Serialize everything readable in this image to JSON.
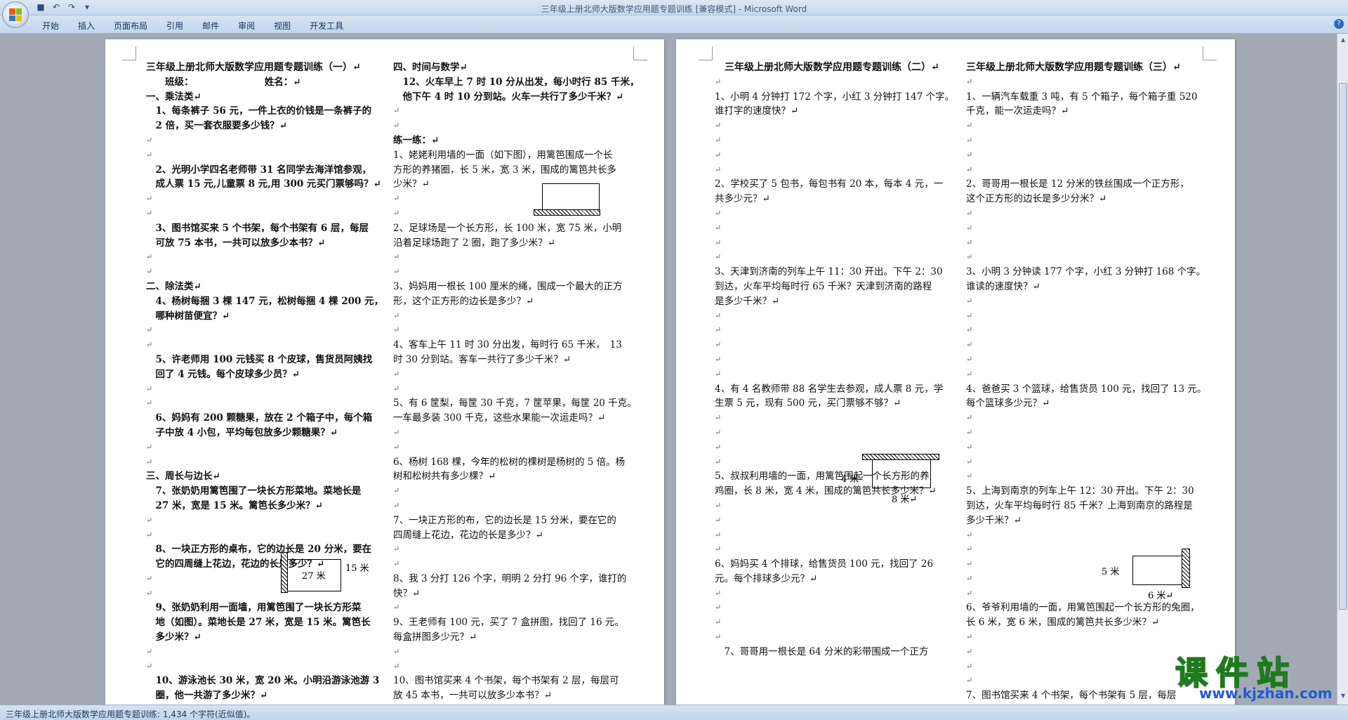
{
  "window": {
    "title": "三年级上册北师大版数学应用题专题训练 [兼容模式] - Microsoft Word"
  },
  "ribbon": {
    "tabs": [
      "开始",
      "插入",
      "页面布局",
      "引用",
      "邮件",
      "审阅",
      "视图",
      "开发工具"
    ]
  },
  "status": {
    "text": "三年级上册北师大版数学应用题专题训练: 1,434 个字符(近似值)。"
  },
  "watermark": {
    "cn": "课件站",
    "url": "www.kjzhan.com"
  },
  "page1_left": [
    {
      "t": "三年级上册北师大版数学应用题专题训练（一）↵",
      "s": "title"
    },
    {
      "t": "　　班级：　　　　　　　　姓名：↵",
      "s": "b"
    },
    {
      "t": "一、乘法类↵",
      "s": "b"
    },
    {
      "t": "　1、每条裤子 56 元，一件上衣的价钱是一条裤子的",
      "s": "b"
    },
    {
      "t": "　2 倍，买一套衣服要多少钱？↵",
      "s": "b"
    },
    {
      "t": "↵",
      "s": "mark"
    },
    {
      "t": "↵",
      "s": "mark"
    },
    {
      "t": "　2、光明小学四名老师带 31 名同学去海洋馆参观，",
      "s": "b"
    },
    {
      "t": "　成人票 15 元,儿童票 8 元,用 300 元买门票够吗？↵",
      "s": "b"
    },
    {
      "t": "↵",
      "s": "mark"
    },
    {
      "t": "↵",
      "s": "mark"
    },
    {
      "t": "　3、图书馆买来 5 个书架，每个书架有 6 层，每层",
      "s": "b"
    },
    {
      "t": "　可放 75 本书，一共可以放多少本书？↵",
      "s": "b"
    },
    {
      "t": "↵",
      "s": "mark"
    },
    {
      "t": "↵",
      "s": "mark"
    },
    {
      "t": "二、除法类↵",
      "s": "b"
    },
    {
      "t": "　4、杨树每捆 3 棵 147 元，松树每捆 4 棵 200 元，",
      "s": "b"
    },
    {
      "t": "　哪种树苗便宜？↵",
      "s": "b"
    },
    {
      "t": "↵",
      "s": "mark"
    },
    {
      "t": "↵",
      "s": "mark"
    },
    {
      "t": "　5、许老师用 100 元钱买 8 个皮球，售货员阿姨找",
      "s": "b"
    },
    {
      "t": "　回了 4 元钱。每个皮球多少员？↵",
      "s": "b"
    },
    {
      "t": "↵",
      "s": "mark"
    },
    {
      "t": "↵",
      "s": "mark"
    },
    {
      "t": "　6、妈妈有 200 颗糖果，放在 2 个箱子中，每个箱",
      "s": "b"
    },
    {
      "t": "　子中放 4 小包，平均每包放多少颗糖果？↵",
      "s": "b"
    },
    {
      "t": "↵",
      "s": "mark"
    },
    {
      "t": "↵",
      "s": "mark"
    },
    {
      "t": "三、周长与边长↵",
      "s": "b"
    },
    {
      "t": "　7、张奶奶用篱笆围了一块长方形菜地。菜地长是",
      "s": "b"
    },
    {
      "t": "　27 米，宽是 15 米。篱笆长多少米？↵",
      "s": "b"
    },
    {
      "t": "↵",
      "s": "mark"
    },
    {
      "t": "↵",
      "s": "mark"
    },
    {
      "t": "　8、一块正方形的桌布，它的边长是 20 分米，要在",
      "s": "b"
    },
    {
      "t": "　它的四周缝上花边，花边的长是多少？↵",
      "s": "b"
    },
    {
      "t": "↵",
      "s": "mark"
    },
    {
      "t": "↵",
      "s": "mark"
    },
    {
      "t": "　9、张奶奶利用一面墙，用篱笆围了一块长方形菜",
      "s": "b"
    },
    {
      "t": "　地（如图）。菜地长是 27 米，宽是 15 米。篱笆长",
      "s": "b"
    },
    {
      "t": "　多少米？↵",
      "s": "b"
    },
    {
      "t": "↵",
      "s": "mark"
    },
    {
      "t": "↵",
      "s": "mark"
    },
    {
      "t": "　10、游泳池长 30 米，宽 20 米。小明沿游泳池游 3",
      "s": "b"
    },
    {
      "t": "　圈，他一共游了多少米？↵",
      "s": "b"
    }
  ],
  "page1_right": [
    {
      "t": "四、时间与数学↵",
      "s": "b"
    },
    {
      "t": "　12、火车早上 7 时 10 分从出发，每小时行 85 千米，",
      "s": "b"
    },
    {
      "t": "　他下午 4 时 10 分到站。火车一共行了多少千米？↵",
      "s": "b"
    },
    {
      "t": "↵",
      "s": "mark"
    },
    {
      "t": "↵",
      "s": "mark"
    },
    {
      "t": "练一练：↵",
      "s": "b"
    },
    {
      "t": "1、姥姥利用墙的一面（如下图），用篱笆围成一个长",
      "s": ""
    },
    {
      "t": "方形的养猪圈，长 5 米，宽 3 米，围成的篱笆共长多",
      "s": ""
    },
    {
      "t": "少米？↵",
      "s": ""
    },
    {
      "t": "↵",
      "s": "mark"
    },
    {
      "t": "↵",
      "s": "mark"
    },
    {
      "t": "2、足球场是一个长方形，长 100 米，宽 75 米，小明",
      "s": ""
    },
    {
      "t": "沿着足球场跑了 2 圈，跑了多少米？↵",
      "s": ""
    },
    {
      "t": "↵",
      "s": "mark"
    },
    {
      "t": "↵",
      "s": "mark"
    },
    {
      "t": "3、妈妈用一根长 100 厘米的绳，围成一个最大的正方",
      "s": ""
    },
    {
      "t": "形，这个正方形的边长是多少？↵",
      "s": ""
    },
    {
      "t": "↵",
      "s": "mark"
    },
    {
      "t": "↵",
      "s": "mark"
    },
    {
      "t": "4、客车上午 11 时 30 分出发，每时行 65 千米，　13",
      "s": ""
    },
    {
      "t": "时 30 分到站。客车一共行了多少千米？↵",
      "s": ""
    },
    {
      "t": "↵",
      "s": "mark"
    },
    {
      "t": "↵",
      "s": "mark"
    },
    {
      "t": "5、有 6 筐梨，每筐 30 千克，7 筐苹果，每筐 20 千克。",
      "s": ""
    },
    {
      "t": "一车最多装 300 千克，这些水果能一次运走吗？↵",
      "s": ""
    },
    {
      "t": "↵",
      "s": "mark"
    },
    {
      "t": "↵",
      "s": "mark"
    },
    {
      "t": "6、杨树 168 棵，今年的松树的棵树是杨树的 5 倍。杨",
      "s": ""
    },
    {
      "t": "树和松树共有多少棵？↵",
      "s": ""
    },
    {
      "t": "↵",
      "s": "mark"
    },
    {
      "t": "↵",
      "s": "mark"
    },
    {
      "t": "7、一块正方形的布，它的边长是 15 分米，要在它的",
      "s": ""
    },
    {
      "t": "四周缝上花边，花边的长是多少？↵",
      "s": ""
    },
    {
      "t": "↵",
      "s": "mark"
    },
    {
      "t": "↵",
      "s": "mark"
    },
    {
      "t": "8、我 3 分打 126 个字，明明 2 分打 96 个字，谁打的",
      "s": ""
    },
    {
      "t": "快？↵",
      "s": ""
    },
    {
      "t": "↵",
      "s": "mark"
    },
    {
      "t": "9、王老师有 100 元，买了 7 盒拼图，找回了 16 元。",
      "s": ""
    },
    {
      "t": "每盒拼图多少元？↵",
      "s": ""
    },
    {
      "t": "↵",
      "s": "mark"
    },
    {
      "t": "↵",
      "s": "mark"
    },
    {
      "t": "10、图书馆买来 4 个书架，每个书架有 2 层，每层可",
      "s": ""
    },
    {
      "t": "放 45 本书，一共可以放多少本书？↵",
      "s": ""
    }
  ],
  "page2_left": [
    {
      "t": "　三年级上册北师大版数学应用题专题训练（二）↵",
      "s": "title"
    },
    {
      "t": "↵",
      "s": "mark"
    },
    {
      "t": "1、小明 4 分钟打 172 个字，小红 3 分钟打 147 个字。",
      "s": ""
    },
    {
      "t": "谁打字的速度快？↵",
      "s": ""
    },
    {
      "t": "↵",
      "s": "mark"
    },
    {
      "t": "↵",
      "s": "mark"
    },
    {
      "t": "↵",
      "s": "mark"
    },
    {
      "t": "↵",
      "s": "mark"
    },
    {
      "t": "2、学校买了 5 包书，每包书有 20 本，每本 4 元，一",
      "s": ""
    },
    {
      "t": "共多少元？↵",
      "s": ""
    },
    {
      "t": "↵",
      "s": "mark"
    },
    {
      "t": "↵",
      "s": "mark"
    },
    {
      "t": "↵",
      "s": "mark"
    },
    {
      "t": "↵",
      "s": "mark"
    },
    {
      "t": "3、天津到济南的列车上午 11：30 开出。下午 2：30",
      "s": ""
    },
    {
      "t": "到达，火车平均每时行 65 千米？天津到济南的路程",
      "s": ""
    },
    {
      "t": "是多少千米？↵",
      "s": ""
    },
    {
      "t": "↵",
      "s": "mark"
    },
    {
      "t": "↵",
      "s": "mark"
    },
    {
      "t": "↵",
      "s": "mark"
    },
    {
      "t": "↵",
      "s": "mark"
    },
    {
      "t": "↵",
      "s": "mark"
    },
    {
      "t": "4、有 4 名教师带 88 名学生去参观，成人票 8 元，学",
      "s": ""
    },
    {
      "t": "生票 5 元，现有 500 元，买门票够不够？↵",
      "s": ""
    },
    {
      "t": "↵",
      "s": "mark"
    },
    {
      "t": "↵",
      "s": "mark"
    },
    {
      "t": "↵",
      "s": "mark"
    },
    {
      "t": "↵",
      "s": "mark"
    },
    {
      "t": "5、叔叔利用墙的一面，用篱笆围起一个长方形的养",
      "s": ""
    },
    {
      "t": "鸡圈，长 8 米，宽 4 米，围成的篱笆共长多少米？↵",
      "s": ""
    },
    {
      "t": "↵",
      "s": "mark"
    },
    {
      "t": "↵",
      "s": "mark"
    },
    {
      "t": "↵",
      "s": "mark"
    },
    {
      "t": "↵",
      "s": "mark"
    },
    {
      "t": "6、妈妈买 4 个排球，给售货员 100 元，找回了 26",
      "s": ""
    },
    {
      "t": "元。每个排球多少元？↵",
      "s": ""
    },
    {
      "t": "↵",
      "s": "mark"
    },
    {
      "t": "↵",
      "s": "mark"
    },
    {
      "t": "↵",
      "s": "mark"
    },
    {
      "t": "↵",
      "s": "mark"
    },
    {
      "t": "　7、哥哥用一根长是 64 分米的彩带围成一个正方",
      "s": ""
    }
  ],
  "page2_right": [
    {
      "t": "三年级上册北师大版数学应用题专题训练（三）↵",
      "s": "title"
    },
    {
      "t": "↵",
      "s": "mark"
    },
    {
      "t": "1、一辆汽车载重 3 吨，有 5 个箱子，每个箱子重 520",
      "s": ""
    },
    {
      "t": "千克，能一次运走吗？↵",
      "s": ""
    },
    {
      "t": "↵",
      "s": "mark"
    },
    {
      "t": "↵",
      "s": "mark"
    },
    {
      "t": "↵",
      "s": "mark"
    },
    {
      "t": "↵",
      "s": "mark"
    },
    {
      "t": "2、哥哥用一根长是 12 分米的铁丝围成一个正方形，",
      "s": ""
    },
    {
      "t": "这个正方形的边长是多少分米？↵",
      "s": ""
    },
    {
      "t": "↵",
      "s": "mark"
    },
    {
      "t": "↵",
      "s": "mark"
    },
    {
      "t": "↵",
      "s": "mark"
    },
    {
      "t": "↵",
      "s": "mark"
    },
    {
      "t": "3、小明 3 分钟读 177 个字，小红 3 分钟打 168 个字。",
      "s": ""
    },
    {
      "t": "谁读的速度快？↵",
      "s": ""
    },
    {
      "t": "↵",
      "s": "mark"
    },
    {
      "t": "↵",
      "s": "mark"
    },
    {
      "t": "↵",
      "s": "mark"
    },
    {
      "t": "↵",
      "s": "mark"
    },
    {
      "t": "↵",
      "s": "mark"
    },
    {
      "t": "↵",
      "s": "mark"
    },
    {
      "t": "4、爸爸买 3 个篮球，给售货员 100 元，找回了 13 元。",
      "s": ""
    },
    {
      "t": "每个篮球多少元？↵",
      "s": ""
    },
    {
      "t": "↵",
      "s": "mark"
    },
    {
      "t": "↵",
      "s": "mark"
    },
    {
      "t": "↵",
      "s": "mark"
    },
    {
      "t": "↵",
      "s": "mark"
    },
    {
      "t": "↵",
      "s": "mark"
    },
    {
      "t": "5、上海到南京的列车上午 12：30 开出。下午 2：30",
      "s": ""
    },
    {
      "t": "到达，火车平均每时行 85 千米？上海到南京的路程是",
      "s": ""
    },
    {
      "t": "多少千米？↵",
      "s": ""
    },
    {
      "t": "↵",
      "s": "mark"
    },
    {
      "t": "↵",
      "s": "mark"
    },
    {
      "t": "↵",
      "s": "mark"
    },
    {
      "t": "↵",
      "s": "mark"
    },
    {
      "t": "↵",
      "s": "mark"
    },
    {
      "t": "6、爷爷利用墙的一面，用篱笆围起一个长方形的兔圈，",
      "s": ""
    },
    {
      "t": "长 6 米，宽 6 米，围成的篱笆共长多少米？↵",
      "s": ""
    },
    {
      "t": "↵",
      "s": "mark"
    },
    {
      "t": "↵",
      "s": "mark"
    },
    {
      "t": "↵",
      "s": "mark"
    },
    {
      "t": "↵",
      "s": "mark"
    },
    {
      "t": "7、图书馆买来 4 个书架，每个书架有 5 层，每层",
      "s": ""
    }
  ],
  "figures": {
    "fig_p1_label_a": "27 米",
    "fig_p1_label_b": "15 米",
    "fig_p2a_label_a": "4 米",
    "fig_p2a_label_b": "8 米↵",
    "fig_p2b_label_a": "5 米",
    "fig_p2b_label_b": "6 米↵"
  }
}
